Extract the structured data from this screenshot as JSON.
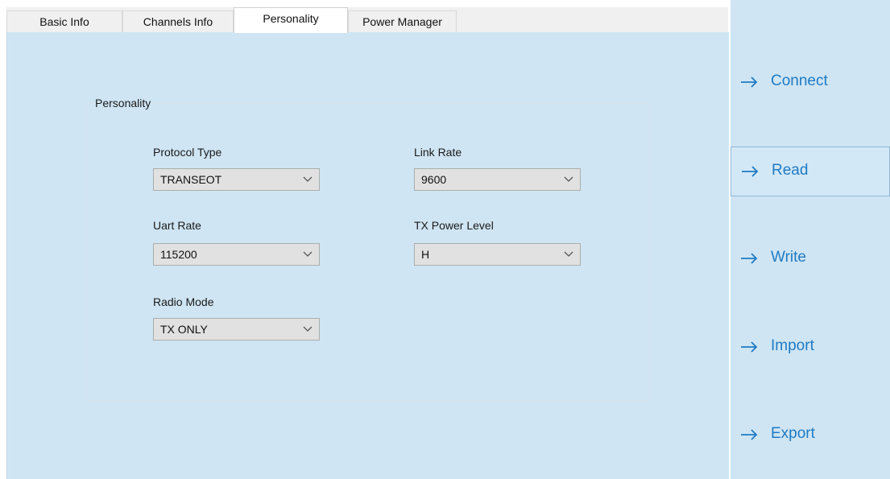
{
  "tabs": [
    {
      "label": "Basic Info"
    },
    {
      "label": "Channels Info"
    },
    {
      "label": "Personality"
    },
    {
      "label": "Power Manager"
    }
  ],
  "personality": {
    "group_title": "Personality",
    "protocol_type": {
      "label": "Protocol Type",
      "value": "TRANSEOT"
    },
    "link_rate": {
      "label": "Link Rate",
      "value": "9600"
    },
    "uart_rate": {
      "label": "Uart Rate",
      "value": "115200"
    },
    "tx_power_level": {
      "label": "TX Power Level",
      "value": "H"
    },
    "radio_mode": {
      "label": "Radio Mode",
      "value": "TX ONLY"
    }
  },
  "actions": {
    "connect": "Connect",
    "read": "Read",
    "write": "Write",
    "import": "Import",
    "export": "Export"
  },
  "colors": {
    "panel_background": "#cfe5f3",
    "action_text": "#1f7bc4",
    "combo_background": "#e1e1e1"
  },
  "icons": {
    "action_arrow": "arrow-right-icon",
    "combo_chevron": "chevron-down-icon"
  }
}
